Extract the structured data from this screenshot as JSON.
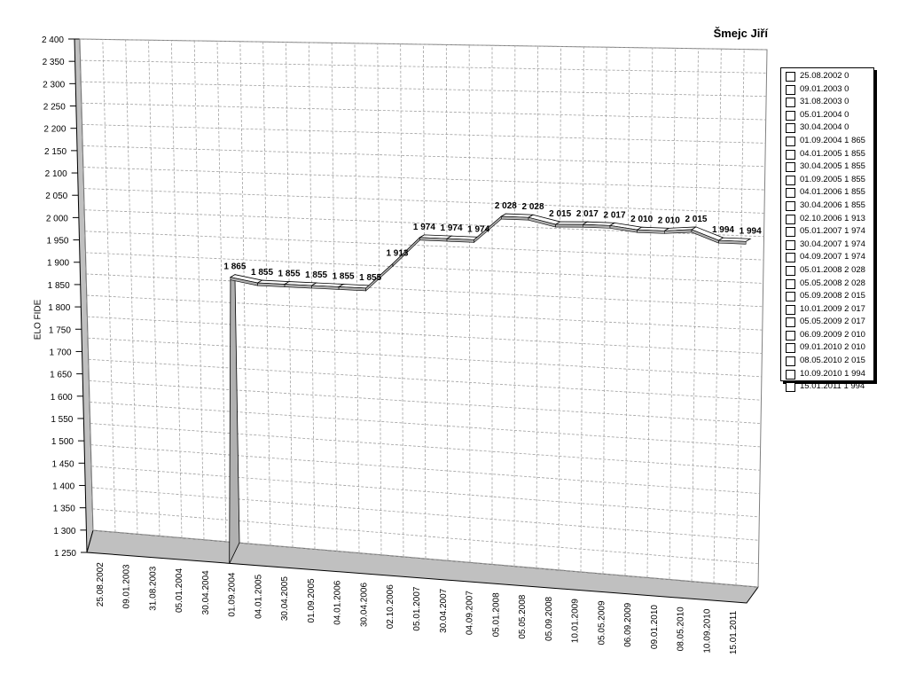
{
  "chart_data": {
    "type": "line",
    "title": "Šmejc Jiří",
    "ylabel": "ELO FIDE",
    "xlabel": "",
    "ylim": [
      1250,
      2400
    ],
    "yticks": [
      "1 250",
      "1 300",
      "1 350",
      "1 400",
      "1 450",
      "1 500",
      "1 550",
      "1 600",
      "1 650",
      "1 700",
      "1 750",
      "1 800",
      "1 850",
      "1 900",
      "1 950",
      "2 000",
      "2 050",
      "2 100",
      "2 150",
      "2 200",
      "2 250",
      "2 300",
      "2 350",
      "2 400"
    ],
    "categories": [
      "25.08.2002",
      "09.01.2003",
      "31.08.2003",
      "05.01.2004",
      "30.04.2004",
      "01.09.2004",
      "04.01.2005",
      "30.04.2005",
      "01.09.2005",
      "04.01.2006",
      "30.04.2006",
      "02.10.2006",
      "05.01.2007",
      "30.04.2007",
      "04.09.2007",
      "05.01.2008",
      "05.05.2008",
      "05.09.2008",
      "10.01.2009",
      "05.05.2009",
      "06.09.2009",
      "09.01.2010",
      "08.05.2010",
      "10.09.2010",
      "15.01.2011"
    ],
    "values": [
      0,
      0,
      0,
      0,
      0,
      1865,
      1855,
      1855,
      1855,
      1855,
      1855,
      1913,
      1974,
      1974,
      1974,
      2028,
      2028,
      2015,
      2017,
      2017,
      2010,
      2010,
      2015,
      1994,
      1994
    ],
    "data_labels": [
      "",
      "",
      "",
      "",
      "",
      "1 865",
      "1 855",
      "1 855",
      "1 855",
      "1 855",
      "1 855",
      "1 913",
      "1 974",
      "1 974",
      "1 974",
      "2 028",
      "2 028",
      "2 015",
      "2 017",
      "2 017",
      "2 010",
      "2 010",
      "2 015",
      "1 994",
      "1 994"
    ],
    "legend": [
      "25.08.2002 0",
      "09.01.2003 0",
      "31.08.2003 0",
      "05.01.2004 0",
      "30.04.2004 0",
      "01.09.2004 1 865",
      "04.01.2005 1 855",
      "30.04.2005 1 855",
      "01.09.2005 1 855",
      "04.01.2006 1 855",
      "30.04.2006 1 855",
      "02.10.2006 1 913",
      "05.01.2007 1 974",
      "30.04.2007 1 974",
      "04.09.2007 1 974",
      "05.01.2008 2 028",
      "05.05.2008 2 028",
      "05.09.2008 2 015",
      "10.01.2009 2 017",
      "05.05.2009 2 017",
      "06.09.2009 2 010",
      "09.01.2010 2 010",
      "08.05.2010 2 015",
      "10.09.2010 1 994",
      "15.01.2011 1 994"
    ],
    "legend_position": "right",
    "grid": true,
    "colors": {
      "line_fill": "#ffffff",
      "line_side": "#b0b0b0",
      "grid": "#a0a0a0",
      "wall": "#c0c0c0"
    }
  }
}
